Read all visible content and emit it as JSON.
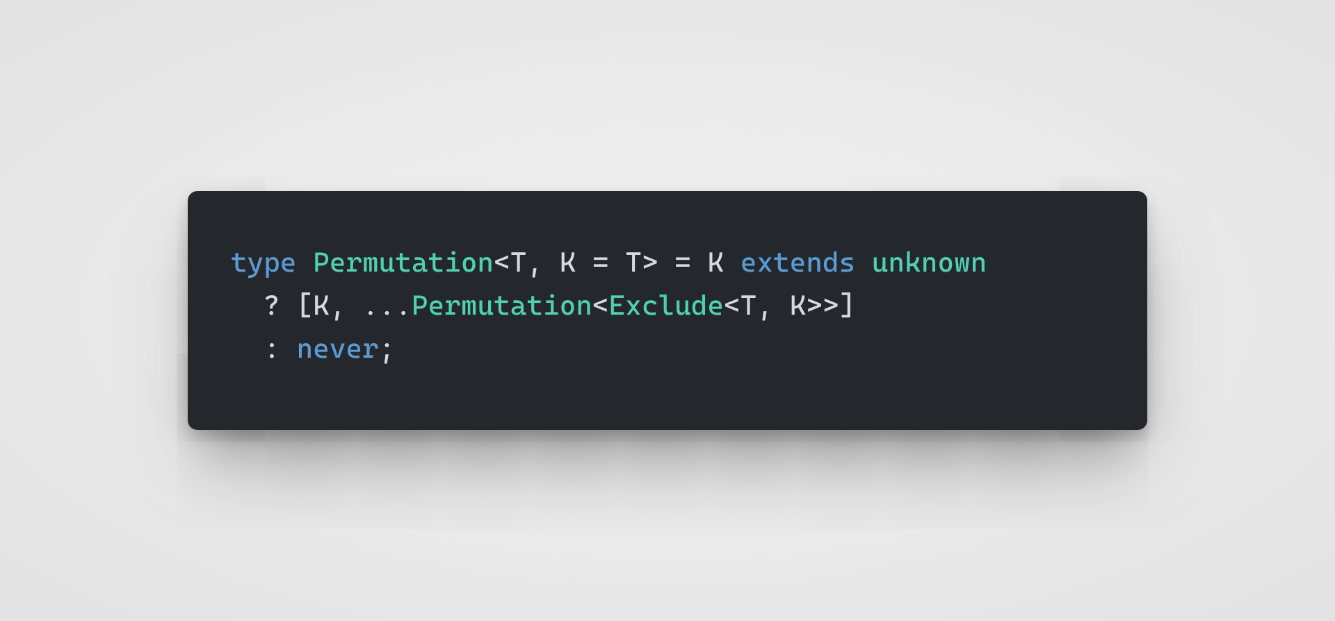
{
  "code": {
    "language": "typescript",
    "tokens": [
      {
        "cls": "tok-keyword",
        "text": "type "
      },
      {
        "cls": "tok-typename",
        "text": "Permutation"
      },
      {
        "cls": "tok-punct",
        "text": "<"
      },
      {
        "cls": "tok-typeparam",
        "text": "T"
      },
      {
        "cls": "tok-punct",
        "text": ", "
      },
      {
        "cls": "tok-typeparam",
        "text": "K"
      },
      {
        "cls": "tok-punct",
        "text": " = "
      },
      {
        "cls": "tok-typeparam",
        "text": "T"
      },
      {
        "cls": "tok-punct",
        "text": "> = "
      },
      {
        "cls": "tok-typeparam",
        "text": "K"
      },
      {
        "cls": "tok-punct",
        "text": " "
      },
      {
        "cls": "tok-keyword",
        "text": "extends"
      },
      {
        "cls": "tok-punct",
        "text": " "
      },
      {
        "cls": "tok-builtin",
        "text": "unknown"
      },
      {
        "cls": "newline",
        "text": "\n"
      },
      {
        "cls": "tok-punct",
        "text": "  ? ["
      },
      {
        "cls": "tok-typeparam",
        "text": "K"
      },
      {
        "cls": "tok-punct",
        "text": ", ..."
      },
      {
        "cls": "tok-typename",
        "text": "Permutation"
      },
      {
        "cls": "tok-punct",
        "text": "<"
      },
      {
        "cls": "tok-typename",
        "text": "Exclude"
      },
      {
        "cls": "tok-punct",
        "text": "<"
      },
      {
        "cls": "tok-typeparam",
        "text": "T"
      },
      {
        "cls": "tok-punct",
        "text": ", "
      },
      {
        "cls": "tok-typeparam",
        "text": "K"
      },
      {
        "cls": "tok-punct",
        "text": ">>]"
      },
      {
        "cls": "newline",
        "text": "\n"
      },
      {
        "cls": "tok-punct",
        "text": "  : "
      },
      {
        "cls": "tok-keyword",
        "text": "never"
      },
      {
        "cls": "tok-punct",
        "text": ";"
      }
    ],
    "plain": "type Permutation<T, K = T> = K extends unknown\n  ? [K, ...Permutation<Exclude<T, K>>]\n  : never;"
  },
  "colors": {
    "card_bg": "#24272c",
    "page_bg": "#ececec",
    "keyword": "#5a9bd4",
    "typename": "#4fd0b3",
    "default": "#d6d9dd"
  }
}
